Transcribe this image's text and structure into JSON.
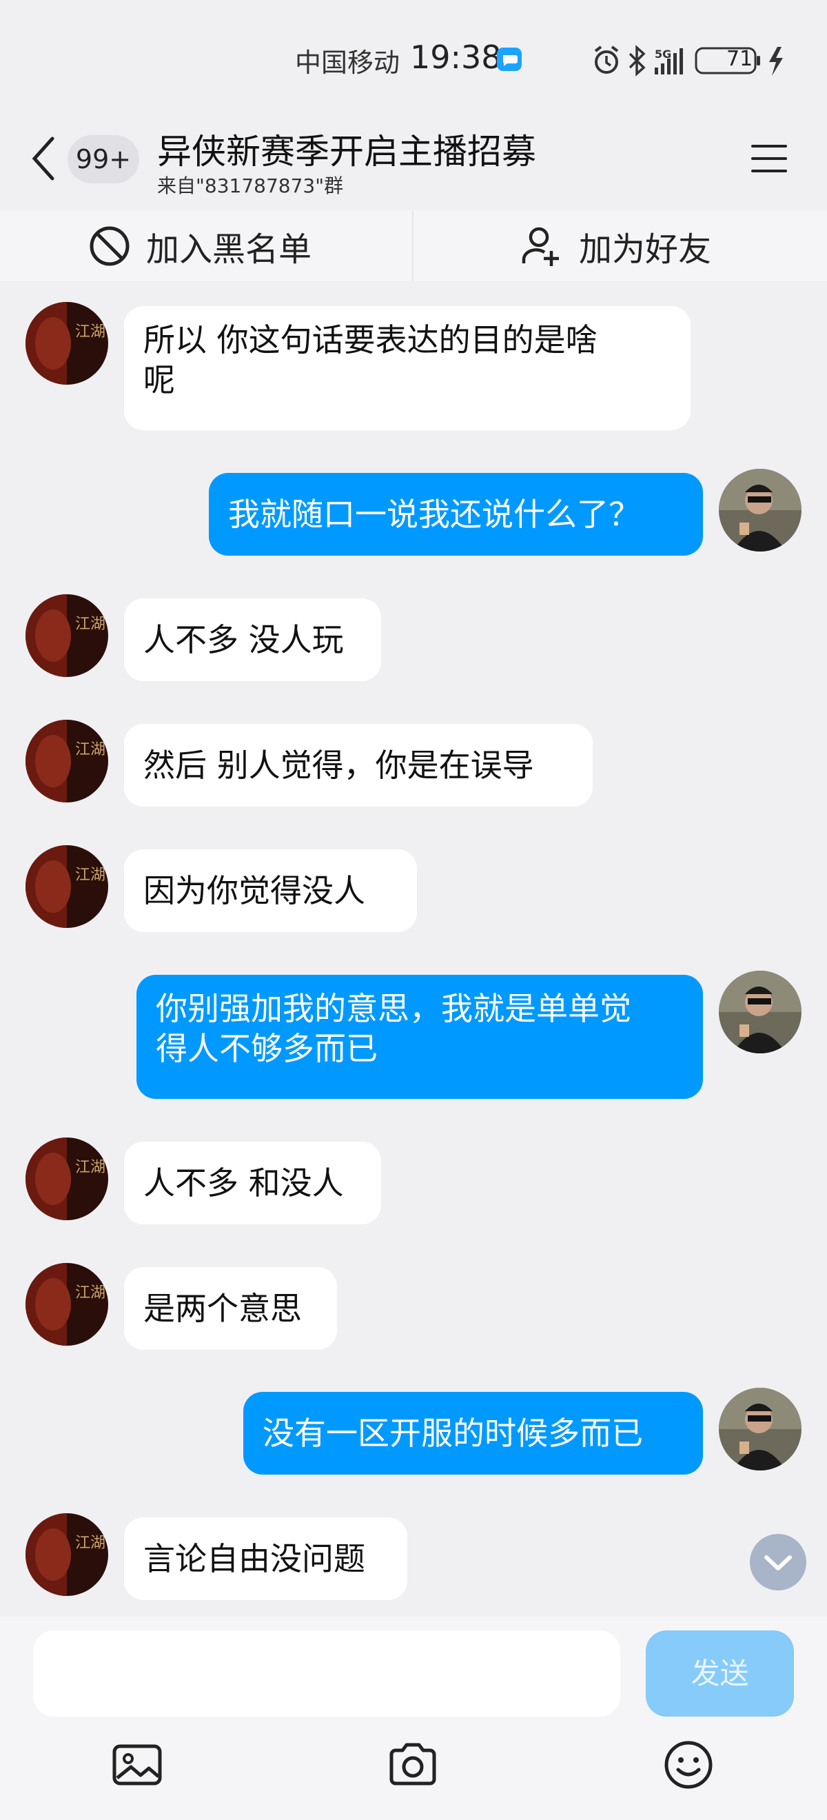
{
  "status_bar": {
    "carrier": "中国移动",
    "time": "19:38",
    "battery": "71",
    "network": "5G"
  },
  "header": {
    "unread_count": "99+",
    "title": "异侠新赛季开启主播招募",
    "subtitle": "来自\"831787873\"群"
  },
  "actions": {
    "blacklist_label": "加入黑名单",
    "add_friend_label": "加为好友"
  },
  "messages": [
    {
      "side": "in",
      "text_lines": [
        "所以 你这句话要表达的目的是啥",
        "呢"
      ]
    },
    {
      "side": "out",
      "text_lines": [
        "我就随口一说我还说什么了？"
      ]
    },
    {
      "side": "in",
      "text_lines": [
        "人不多 没人玩"
      ]
    },
    {
      "side": "in",
      "text_lines": [
        "然后 别人觉得，你是在误导"
      ]
    },
    {
      "side": "in",
      "text_lines": [
        "因为你觉得没人"
      ]
    },
    {
      "side": "out",
      "text_lines": [
        "你别强加我的意思，我就是单单觉",
        "得人不够多而已"
      ]
    },
    {
      "side": "in",
      "text_lines": [
        "人不多 和没人"
      ]
    },
    {
      "side": "in",
      "text_lines": [
        "是两个意思"
      ]
    },
    {
      "side": "out",
      "text_lines": [
        "没有一区开服的时候多而已"
      ]
    },
    {
      "side": "in",
      "text_lines": [
        "言论自由没问题"
      ]
    }
  ],
  "avatars": {
    "incoming_text": "江湖"
  },
  "input": {
    "placeholder": "",
    "send_label": "发送"
  },
  "toolbar": {
    "icons": [
      "image-icon",
      "camera-icon",
      "emoji-icon"
    ]
  },
  "colors": {
    "outgoing_bubble": "#0099ff",
    "incoming_bubble": "#ffffff",
    "send_button": "#86cbf9",
    "background": "#f0f0f3"
  }
}
